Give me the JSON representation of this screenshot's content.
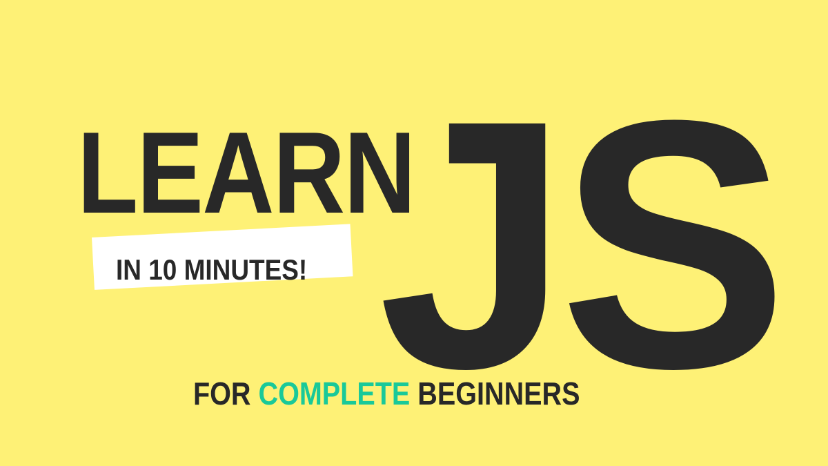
{
  "headline": {
    "learn": "LEARN",
    "js": "JS"
  },
  "badge": {
    "text": "IN 10 MINUTES!"
  },
  "tagline": {
    "prefix": "FOR",
    "highlight": "COMPLETE",
    "suffix": "BEGINNERS"
  },
  "colors": {
    "background": "#fef176",
    "text": "#282828",
    "accent": "#19c999",
    "badge_background": "#ffffff"
  }
}
